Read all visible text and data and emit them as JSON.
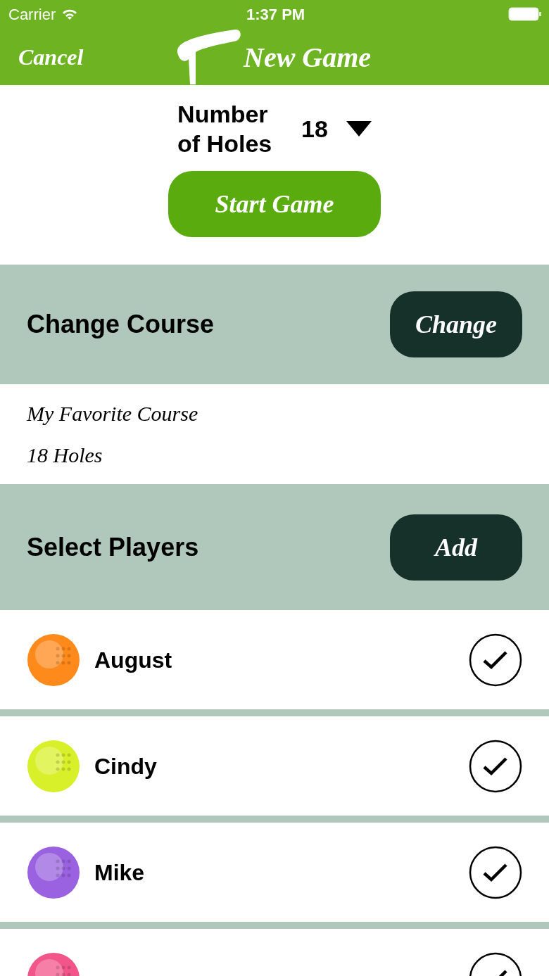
{
  "status_bar": {
    "carrier": "Carrier",
    "time": "1:37 PM"
  },
  "nav": {
    "cancel": "Cancel",
    "title": "New Game"
  },
  "holes": {
    "label": "Number of Holes",
    "value": "18"
  },
  "start_button": "Start Game",
  "course_section": {
    "title": "Change Course",
    "button": "Change"
  },
  "course": {
    "name": "My Favorite Course",
    "holes": "18 Holes"
  },
  "players_section": {
    "title": "Select Players",
    "button": "Add"
  },
  "players": [
    {
      "name": "August",
      "color": "#ff8a1c",
      "checked": true
    },
    {
      "name": "Cindy",
      "color": "#d8f02a",
      "checked": true
    },
    {
      "name": "Mike",
      "color": "#9a62e0",
      "checked": true
    },
    {
      "color": "#f2558a",
      "checked": true
    }
  ]
}
